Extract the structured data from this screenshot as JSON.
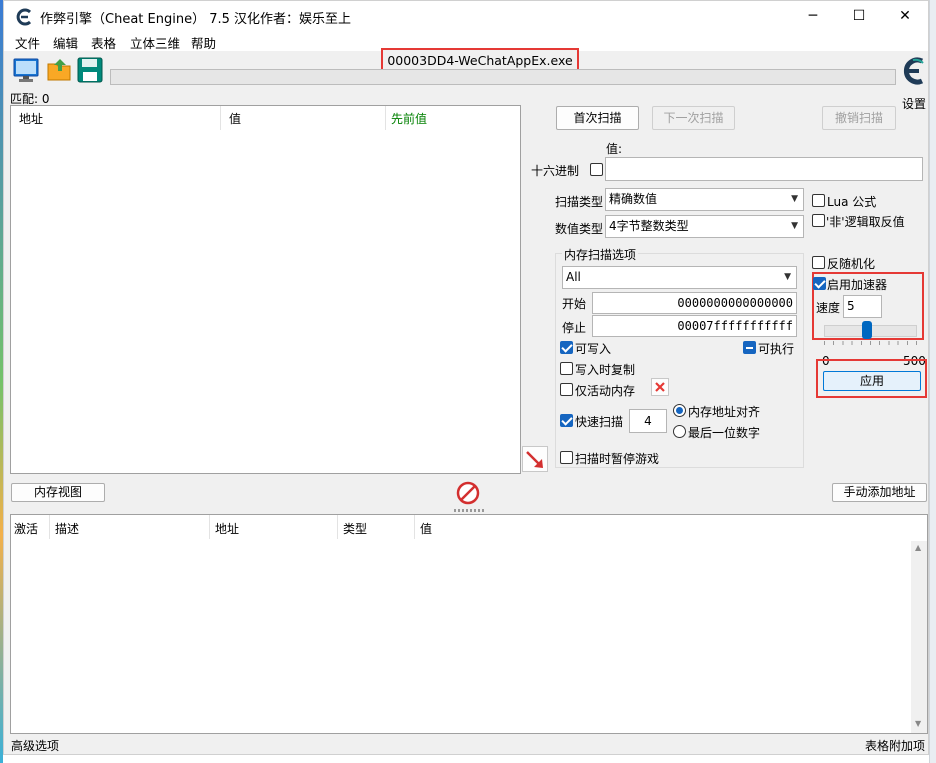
{
  "window": {
    "title": "作弊引擎（Cheat Engine） 7.5 汉化作者：娱乐至上",
    "minimize": "─",
    "maximize": "☐",
    "close": "✕"
  },
  "menu": [
    "文件",
    "编辑",
    "表格",
    "立体三维",
    "帮助"
  ],
  "toolbar": {
    "process_name": "00003DD4-WeChatAppEx.exe",
    "settings_label": "设置",
    "match_label": "匹配: 0"
  },
  "results_table": {
    "columns": [
      "地址",
      "值",
      "先前值"
    ],
    "prev_value_color": "#008000"
  },
  "scan": {
    "first_scan": "首次扫描",
    "next_scan": "下一次扫描",
    "undo_scan": "撤销扫描",
    "value_label": "值:",
    "hex_label": "十六进制",
    "value_input": "",
    "scan_type_label": "扫描类型",
    "scan_type_value": "精确数值",
    "value_type_label": "数值类型",
    "value_type_value": "4字节整数类型",
    "lua_label": "Lua 公式",
    "not_logic_label": "'非'逻辑取反值"
  },
  "memory_options": {
    "title": "内存扫描选项",
    "region": "All",
    "start_label": "开始",
    "start_value": "0000000000000000",
    "stop_label": "停止",
    "stop_value": "00007fffffffffff",
    "writable_label": "可写入",
    "executable_label": "可执行",
    "copy_on_write_label": "写入时复制",
    "active_memory_label": "仅活动内存",
    "fast_scan_label": "快速扫描",
    "fast_scan_value": "4",
    "align_label": "内存地址对齐",
    "last_digit_label": "最后一位数字",
    "pause_label": "扫描时暂停游戏"
  },
  "speedhack": {
    "randomize_label": "反随机化",
    "enable_label": "启用加速器",
    "speed_label": "速度",
    "speed_value": "5",
    "slider_fraction": 0.1,
    "slider_min": "0",
    "slider_max": "500",
    "apply_label": "应用"
  },
  "bottom": {
    "memory_view": "内存视图",
    "add_address": "手动添加地址",
    "columns": [
      "激活",
      "描述",
      "地址",
      "类型",
      "值"
    ],
    "advanced": "高级选项",
    "table_extras": "表格附加项"
  },
  "highlight_color": "#e53935"
}
